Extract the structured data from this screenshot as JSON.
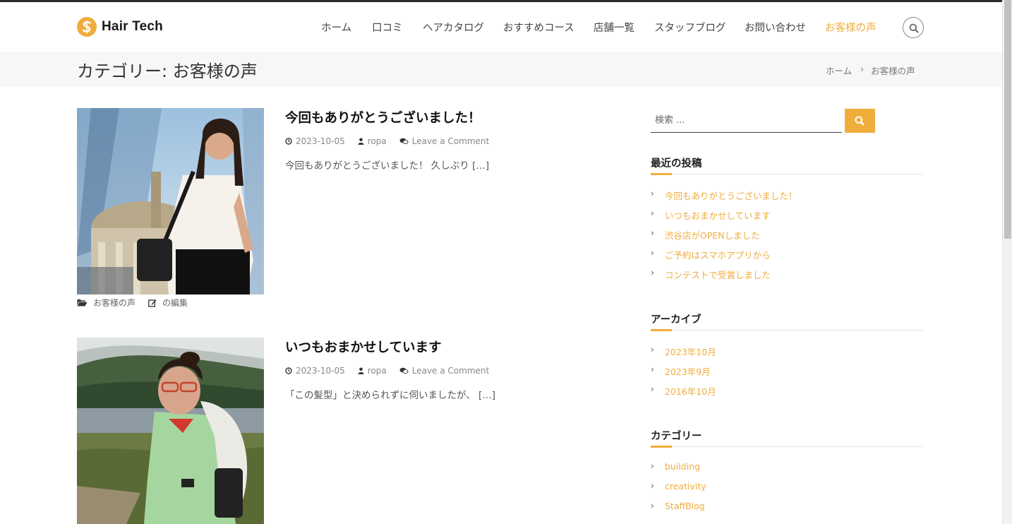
{
  "site": {
    "name": "Hair Tech",
    "accent": "#f0ad3c"
  },
  "nav": [
    {
      "label": "ホーム",
      "active": false
    },
    {
      "label": "口コミ",
      "active": false
    },
    {
      "label": "ヘアカタログ",
      "active": false
    },
    {
      "label": "おすすめコース",
      "active": false
    },
    {
      "label": "店舗一覧",
      "active": false
    },
    {
      "label": "スタッフブログ",
      "active": false
    },
    {
      "label": "お問い合わせ",
      "active": false
    },
    {
      "label": "お客様の声",
      "active": true
    }
  ],
  "banner": {
    "title": "カテゴリー: お客様の声",
    "breadcrumb": [
      "ホーム",
      "お客様の声"
    ]
  },
  "posts": [
    {
      "title": "今回もありがとうございました！",
      "date": "2023-10-05",
      "author": "ropa",
      "comments": "Leave a Comment",
      "excerpt": "今回もありがとうございました！ 久しぶり […]",
      "category": "お客様の声",
      "edit": "の編集"
    },
    {
      "title": "いつもおまかせしています",
      "date": "2023-10-05",
      "author": "ropa",
      "comments": "Leave a Comment",
      "excerpt": "「この髪型」と決められずに伺いましたが、 […]"
    }
  ],
  "sidebar": {
    "search_placeholder": "検索 ...",
    "recent": {
      "title": "最近の投稿",
      "items": [
        "今回もありがとうございました！",
        "いつもおまかせしています",
        "渋谷店がOPENしました",
        "ご予約はスマホアプリから",
        "コンテストで受賞しました"
      ]
    },
    "archive": {
      "title": "アーカイブ",
      "items": [
        "2023年10月",
        "2023年9月",
        "2016年10月"
      ]
    },
    "categories": {
      "title": "カテゴリー",
      "items": [
        "building",
        "creativity",
        "StaffBlog"
      ]
    }
  }
}
